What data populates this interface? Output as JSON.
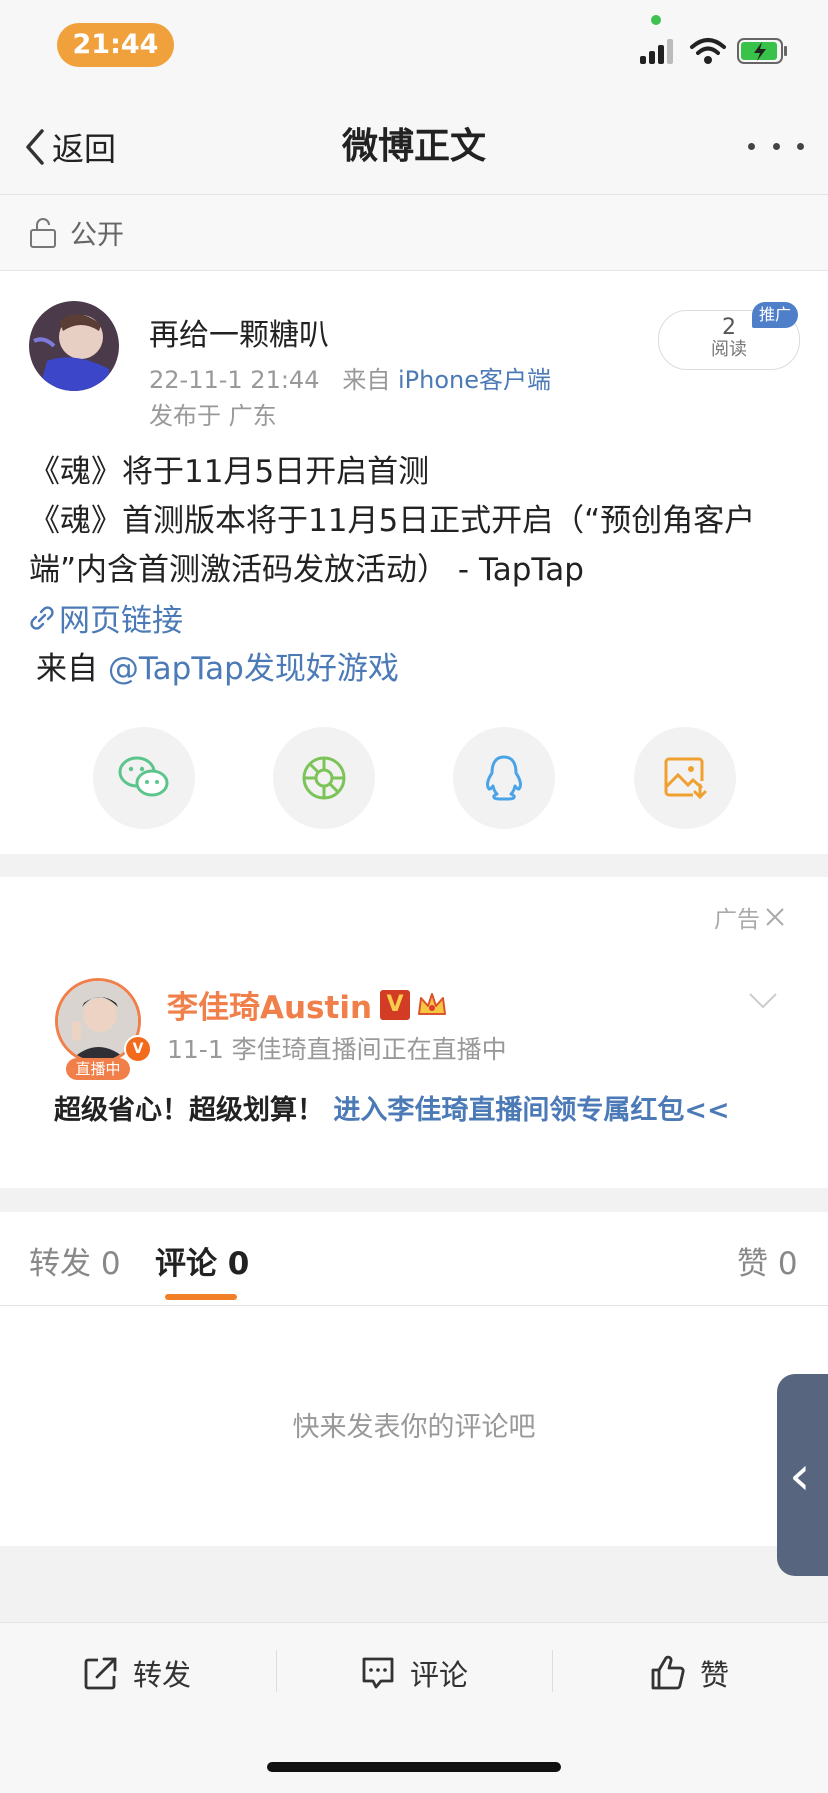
{
  "status_bar": {
    "time": "21:44"
  },
  "nav": {
    "back_label": "返回",
    "title": "微博正文"
  },
  "visibility": {
    "label": "公开"
  },
  "post": {
    "author": "再给一颗糖叭",
    "date": "22-11-1 21:44",
    "from_prefix": "来自",
    "source": "iPhone客户端",
    "location": "发布于 广东",
    "read_count": "2",
    "read_label": "阅读",
    "promo_badge": "推广",
    "line1": "《魂》将于11月5日开启首测",
    "line2": "《魂》首测版本将于11月5日正式开启（“预创角客户端”内含首测激活码发放活动） - TapTap",
    "web_link": "网页链接",
    "from_text": "来自",
    "from_account": "@TapTap发现好游戏"
  },
  "share": {
    "icons": [
      "wechat-icon",
      "moments-icon",
      "qq-icon",
      "save-image-icon"
    ]
  },
  "ad": {
    "label": "广告",
    "name": "李佳琦Austin",
    "verified": "V",
    "live_tag": "直播中",
    "meta": "11-1  李佳琦直播间正在直播中",
    "text": "超级省心！超级划算！",
    "link": "进入李佳琦直播间领专属红包<<"
  },
  "tabs": {
    "repost": "转发 0",
    "comment": "评论 0",
    "like": "赞 0"
  },
  "comments": {
    "empty": "快来发表你的评论吧"
  },
  "bottom_bar": {
    "repost": "转发",
    "comment": "评论",
    "like": "赞"
  },
  "colors": {
    "accent_orange": "#f07f28",
    "link_blue": "#4b7ab6",
    "time_pill": "#f1a13c"
  }
}
